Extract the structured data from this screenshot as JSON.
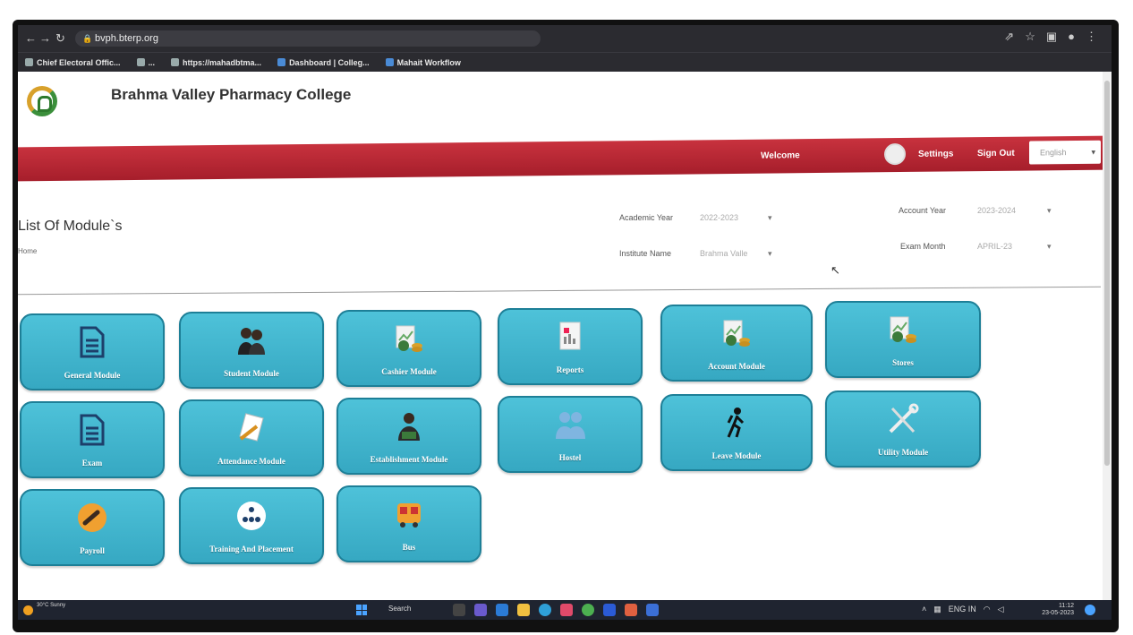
{
  "browser": {
    "address": "bvph.bterp.org",
    "bookmarks": [
      "Chief Electoral Offic...",
      "...",
      "https://mahadbtma...",
      "Dashboard | Colleg...",
      "Mahait Workflow"
    ]
  },
  "header": {
    "college_name": "Brahma Valley Pharmacy College",
    "welcome": "Welcome",
    "username": "",
    "settings": "Settings",
    "sign_out": "Sign Out",
    "language": "English"
  },
  "page": {
    "title": "List Of Module`s",
    "breadcrumb": "Home"
  },
  "filters": {
    "academic_year_label": "Academic Year",
    "academic_year_value": "2022-2023",
    "institute_name_label": "Institute Name",
    "institute_name_value": "Brahma Valle",
    "account_year_label": "Account Year",
    "account_year_value": "2023-2024",
    "exam_month_label": "Exam Month",
    "exam_month_value": "APRIL-23"
  },
  "modules": [
    {
      "label": "General Module",
      "icon": "document-icon"
    },
    {
      "label": "Student Module",
      "icon": "students-icon"
    },
    {
      "label": "Cashier Module",
      "icon": "cashier-icon"
    },
    {
      "label": "Reports",
      "icon": "reports-icon"
    },
    {
      "label": "Account Module",
      "icon": "account-icon"
    },
    {
      "label": "Stores",
      "icon": "stores-icon"
    },
    {
      "label": "Exam",
      "icon": "document-icon"
    },
    {
      "label": "Attendance Module",
      "icon": "attendance-icon"
    },
    {
      "label": "Establishment Module",
      "icon": "establishment-icon"
    },
    {
      "label": "Hostel",
      "icon": "hostel-icon"
    },
    {
      "label": "Leave Module",
      "icon": "hiker-icon"
    },
    {
      "label": "Utility Module",
      "icon": "tools-icon"
    },
    {
      "label": "Payroll",
      "icon": "payroll-icon"
    },
    {
      "label": "Training And Placement",
      "icon": "training-icon"
    },
    {
      "label": "Bus",
      "icon": "bus-icon"
    }
  ],
  "taskbar": {
    "weather": "30°C Sunny",
    "search": "Search",
    "language": "ENG IN",
    "time": "11:12",
    "date": "23-05-2023"
  },
  "colors": {
    "tile": "#3fb3cc",
    "redbar": "#b8293a"
  }
}
